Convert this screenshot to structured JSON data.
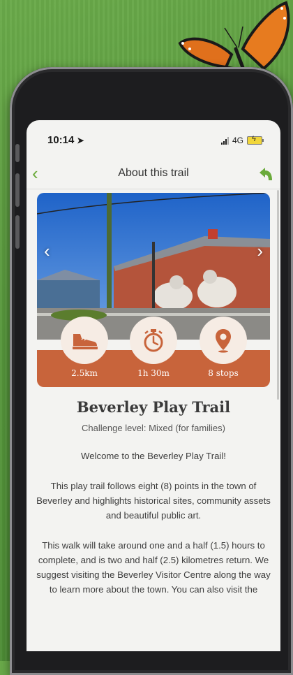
{
  "status_bar": {
    "time": "10:14",
    "network": "4G"
  },
  "nav": {
    "title": "About this trail"
  },
  "stats": [
    {
      "icon": "sneaker-icon",
      "value": "2.5km"
    },
    {
      "icon": "stopwatch-icon",
      "value": "1h 30m"
    },
    {
      "icon": "map-pin-icon",
      "value": "8 stops"
    }
  ],
  "trail": {
    "title": "Beverley Play Trail",
    "challenge": "Challenge level: Mixed (for families)",
    "welcome": "Welcome to the Beverley Play Trail!",
    "para1": "This play trail follows eight (8) points in the town of Beverley and highlights historical sites, community assets and beautiful public art.",
    "para2": "This walk will take around one and a half (1.5) hours to complete, and is two and half (2.5) kilometres return. We suggest visiting the Beverley Visitor Centre along the way to learn more about the town. You can also visit the"
  },
  "colors": {
    "accent_green": "#6aaa3a",
    "stat_band": "#c8643b"
  }
}
